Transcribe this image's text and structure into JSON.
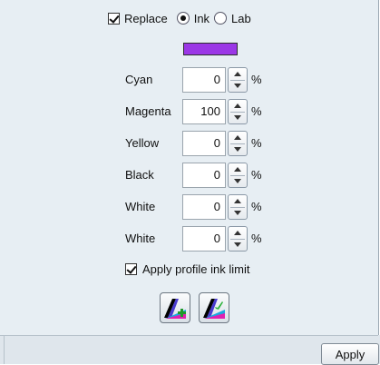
{
  "options": {
    "replace_label": "Replace",
    "replace_checked": true,
    "mode_options": [
      "Ink",
      "Lab"
    ],
    "mode_selected": "Ink"
  },
  "color_swatch": {
    "color": "#9b37e6"
  },
  "inks": [
    {
      "label": "Cyan",
      "value": "0",
      "unit": "%"
    },
    {
      "label": "Magenta",
      "value": "100",
      "unit": "%"
    },
    {
      "label": "Yellow",
      "value": "0",
      "unit": "%"
    },
    {
      "label": "Black",
      "value": "0",
      "unit": "%"
    },
    {
      "label": "White",
      "value": "0",
      "unit": "%"
    },
    {
      "label": "White",
      "value": "0",
      "unit": "%"
    }
  ],
  "limit": {
    "label": "Apply profile ink limit",
    "checked": true
  },
  "tools": [
    {
      "icon": "add-ink-icon"
    },
    {
      "icon": "apply-ink-icon"
    }
  ],
  "footer": {
    "apply_label": "Apply"
  }
}
